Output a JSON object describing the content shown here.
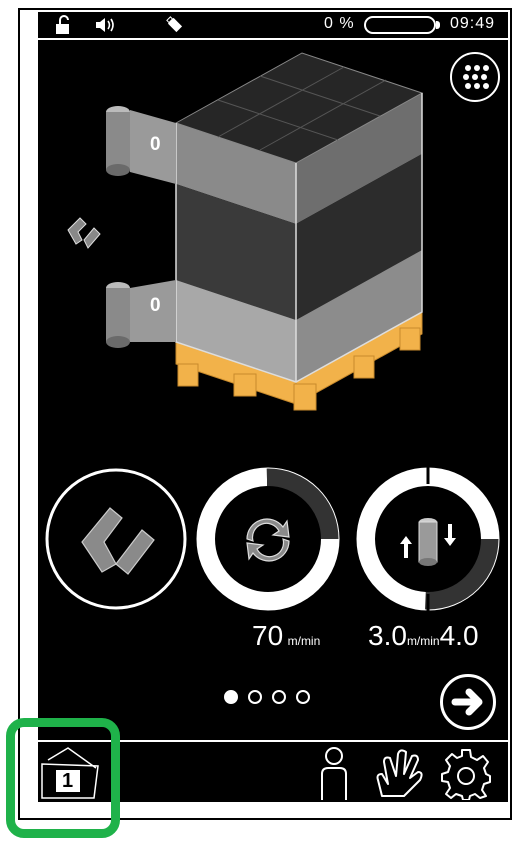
{
  "status_bar": {
    "battery_percent_label": "0 %",
    "battery_level": 0.0,
    "time": "09:49",
    "icons": [
      "unlock-icon",
      "speaker-icon",
      "usb-icon",
      "battery-icon"
    ]
  },
  "reels": {
    "top_value": "0",
    "bottom_value": "0"
  },
  "controls": {
    "rotation_speed_value": "70",
    "rotation_speed_unit": "m/min",
    "film_speed_value": "3.0",
    "film_speed_unit": "m/min",
    "film_speed_value_2": "4.0"
  },
  "pagination": {
    "count": 4,
    "active": 1
  },
  "bottom_bar": {
    "program_number": "1"
  },
  "colors": {
    "background": "#000000",
    "foreground": "#ffffff",
    "pallet": "#f2b24a",
    "highlight": "#1fb24a"
  }
}
